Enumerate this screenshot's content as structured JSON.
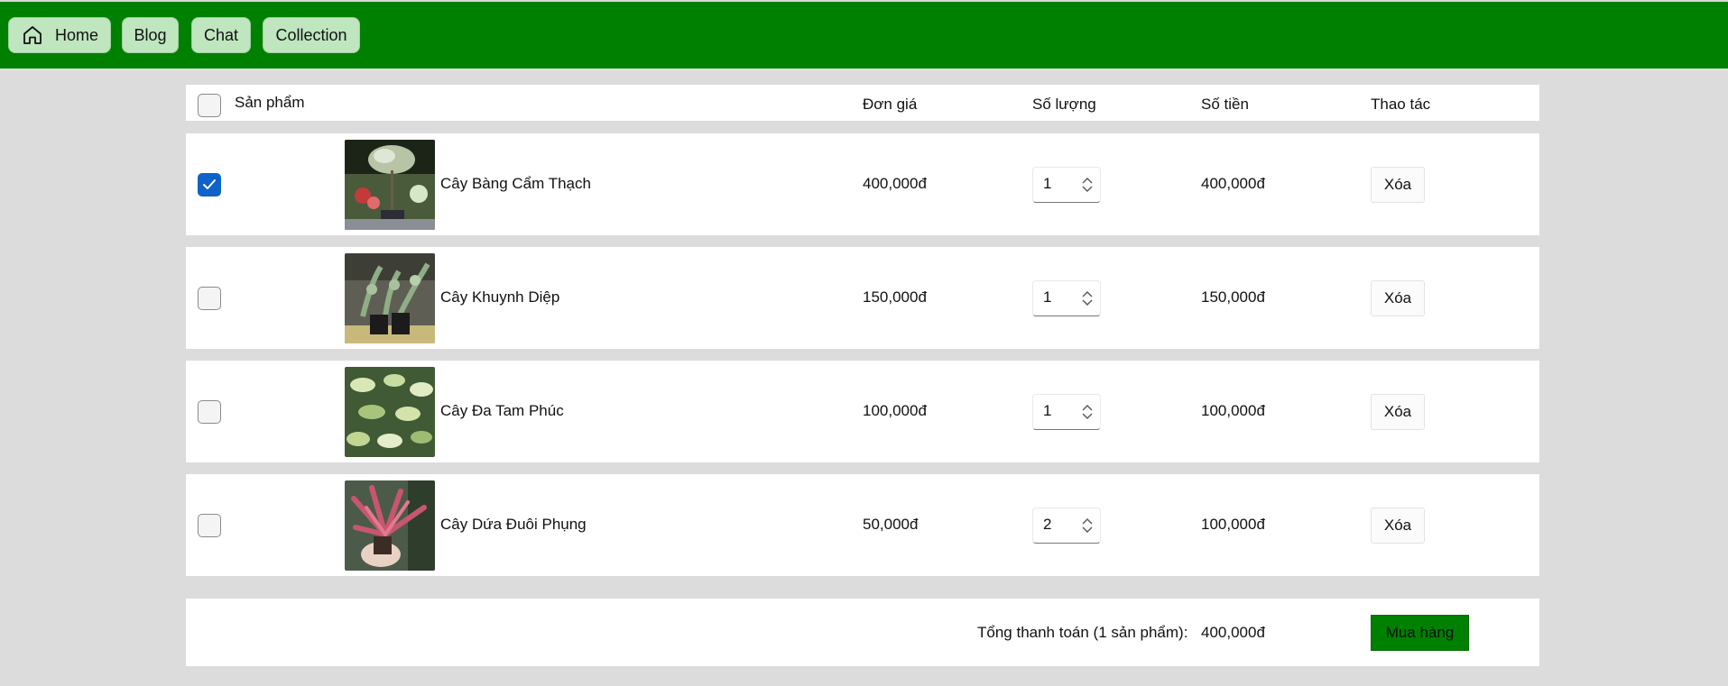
{
  "nav": {
    "home_label": "Home",
    "blog_label": "Blog",
    "chat_label": "Chat",
    "collection_label": "Collection"
  },
  "colors": {
    "topbar": "#008000",
    "nav_button": "#bfe6bf",
    "checkbox_checked": "#0f62c8",
    "buy_button": "#008000",
    "page_background": "#dcdcdc"
  },
  "table": {
    "headers": {
      "product": "Sản phẩm",
      "unit_price": "Đơn giá",
      "quantity": "Số lượng",
      "amount": "Số tiền",
      "actions": "Thao tác"
    },
    "rows": [
      {
        "checked": true,
        "thumbnail": "cay-bang-cam-thach-photo",
        "name": "Cây Bàng Cẩm Thạch",
        "unit_price": "400,000đ",
        "quantity": "1",
        "amount": "400,000đ",
        "delete_label": "Xóa"
      },
      {
        "checked": false,
        "thumbnail": "cay-khuynh-diep-photo",
        "name": "Cây Khuynh Diệp",
        "unit_price": "150,000đ",
        "quantity": "1",
        "amount": "150,000đ",
        "delete_label": "Xóa"
      },
      {
        "checked": false,
        "thumbnail": "cay-da-tam-phuc-photo",
        "name": "Cây Đa Tam Phúc",
        "unit_price": "100,000đ",
        "quantity": "1",
        "amount": "100,000đ",
        "delete_label": "Xóa"
      },
      {
        "checked": false,
        "thumbnail": "cay-dua-duoi-phung-photo",
        "name": "Cây Dứa Đuôi Phụng",
        "unit_price": "50,000đ",
        "quantity": "2",
        "amount": "100,000đ",
        "delete_label": "Xóa"
      }
    ]
  },
  "footer": {
    "total_label": "Tổng thanh toán (1 sản phẩm):",
    "total_value": "400,000đ",
    "buy_label": "Mua hàng"
  }
}
